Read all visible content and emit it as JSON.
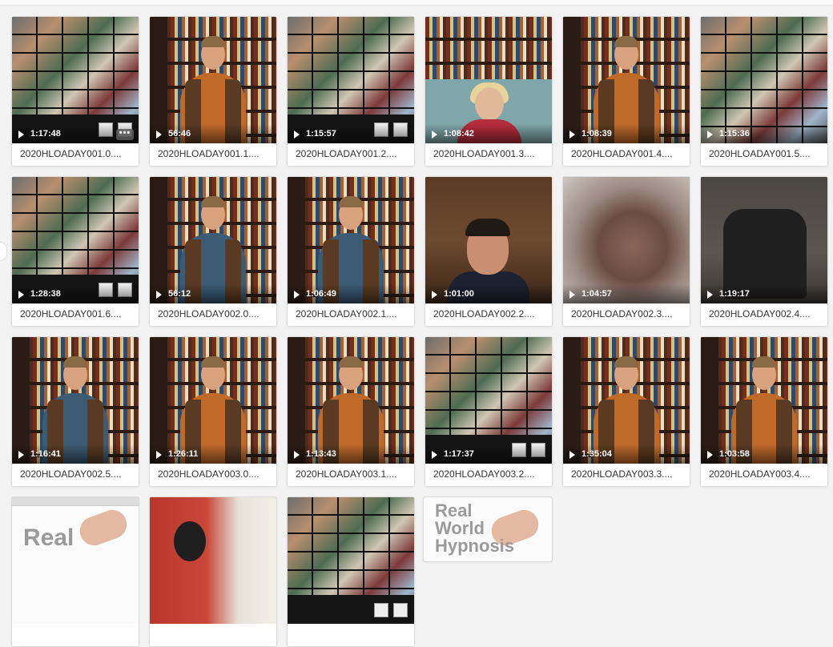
{
  "items": [
    {
      "duration": "1:17:48",
      "name": "2020HLOADAY001.0....",
      "thumb": "grid",
      "more": true
    },
    {
      "duration": "56:46",
      "name": "2020HLOADAY001.1....",
      "thumb": "presenter"
    },
    {
      "duration": "1:15:57",
      "name": "2020HLOADAY001.2....",
      "thumb": "grid"
    },
    {
      "duration": "1:08:42",
      "name": "2020HLOADAY001.3....",
      "thumb": "split"
    },
    {
      "duration": "1:08:39",
      "name": "2020HLOADAY001.4....",
      "thumb": "presenter"
    },
    {
      "duration": "1:15:36",
      "name": "2020HLOADAY001.5....",
      "thumb": "grid4"
    },
    {
      "duration": "1:28:38",
      "name": "2020HLOADAY001.6....",
      "thumb": "grid"
    },
    {
      "duration": "56:12",
      "name": "2020HLOADAY002.0....",
      "thumb": "presenter-blue"
    },
    {
      "duration": "1:06:49",
      "name": "2020HLOADAY002.1....",
      "thumb": "presenter-blue"
    },
    {
      "duration": "1:01:00",
      "name": "2020HLOADAY002.2....",
      "thumb": "closeup"
    },
    {
      "duration": "1:04:57",
      "name": "2020HLOADAY002.3....",
      "thumb": "blur"
    },
    {
      "duration": "1:19:17",
      "name": "2020HLOADAY002.4....",
      "thumb": "chair"
    },
    {
      "duration": "1:16:41",
      "name": "2020HLOADAY002.5....",
      "thumb": "presenter-blue"
    },
    {
      "duration": "1:26:11",
      "name": "2020HLOADAY003.0....",
      "thumb": "presenter"
    },
    {
      "duration": "1:13:43",
      "name": "2020HLOADAY003.1....",
      "thumb": "presenter"
    },
    {
      "duration": "1:17:37",
      "name": "2020HLOADAY003.2....",
      "thumb": "grid"
    },
    {
      "duration": "1:35:04",
      "name": "2020HLOADAY003.3....",
      "thumb": "presenter"
    },
    {
      "duration": "1:03:58",
      "name": "2020HLOADAY003.4....",
      "thumb": "presenter"
    },
    {
      "duration": "",
      "name": "",
      "thumb": "logo-small"
    },
    {
      "duration": "",
      "name": "",
      "thumb": "red"
    },
    {
      "duration": "",
      "name": "",
      "thumb": "grid"
    },
    {
      "duration": "",
      "name": "",
      "thumb": "logo-big"
    }
  ],
  "logo": {
    "line1": "Real",
    "line2": "World",
    "line3": "Hypnosis"
  },
  "colors": {
    "background": "#f3f3f3",
    "card": "#ffffff",
    "text": "#333333"
  }
}
